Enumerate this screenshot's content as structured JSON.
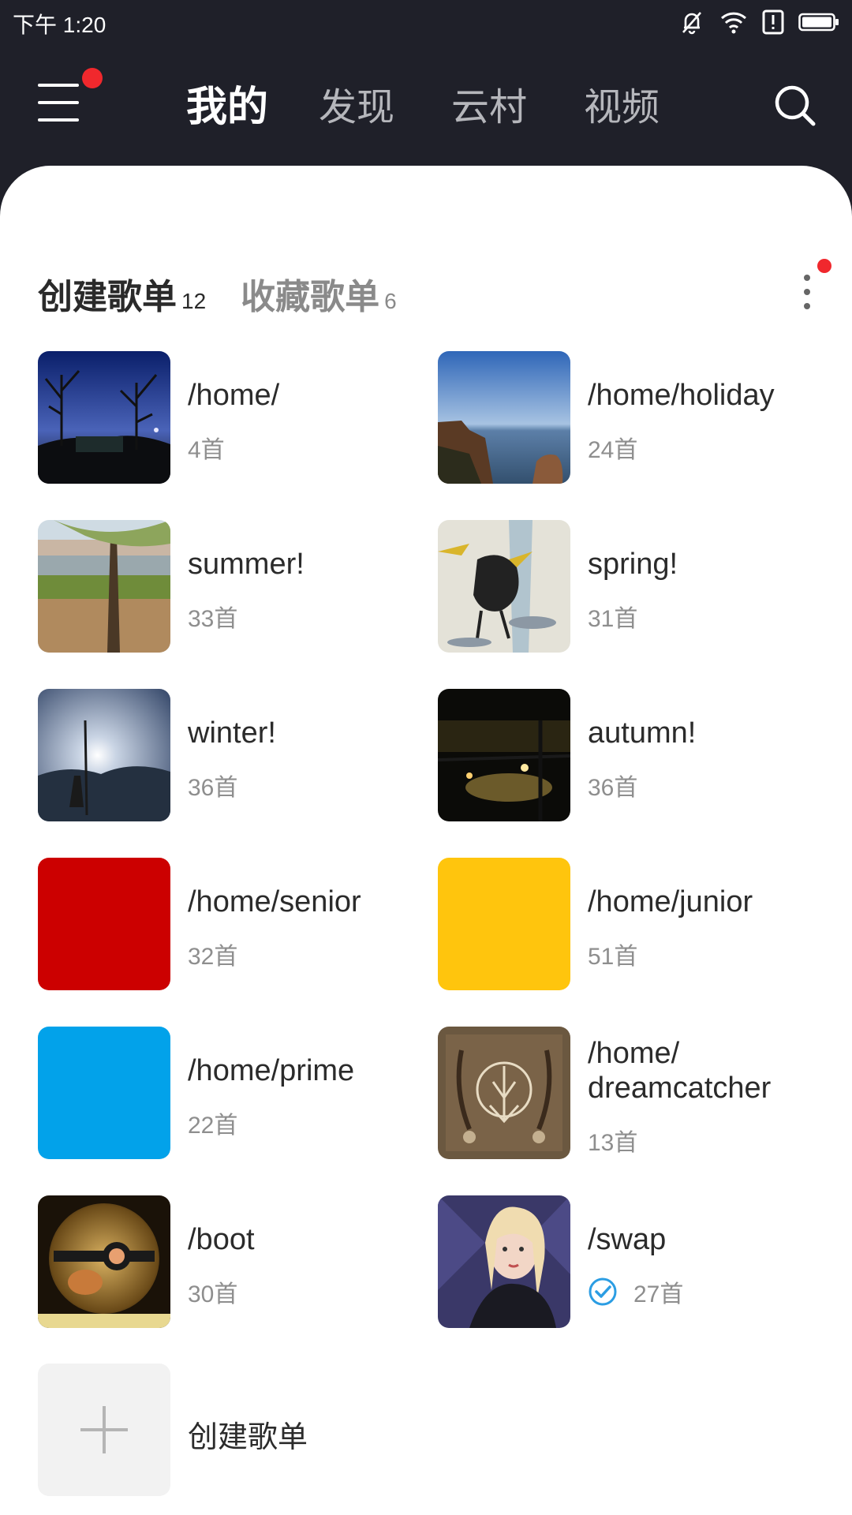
{
  "status_bar": {
    "time": "下午 1:20",
    "icons": [
      "bell-muted-icon",
      "wifi-icon",
      "alert-icon",
      "battery-icon"
    ]
  },
  "nav": {
    "tabs": [
      "我的",
      "发现",
      "云村",
      "视频"
    ],
    "active_tab": 0,
    "menu_badge": true
  },
  "section": {
    "tabs": [
      {
        "label": "创建歌单",
        "count": "12"
      },
      {
        "label": "收藏歌单",
        "count": "6"
      }
    ]
  },
  "playlists": [
    {
      "title": "/home/",
      "count": "4首",
      "cover": "night-park"
    },
    {
      "title": "/home/holiday",
      "count": "24首",
      "cover": "sea-cliff"
    },
    {
      "title": "summer!",
      "count": "33首",
      "cover": "tree-lake"
    },
    {
      "title": "spring!",
      "count": "31首",
      "cover": "ink-bird"
    },
    {
      "title": "winter!",
      "count": "36首",
      "cover": "moon-beach"
    },
    {
      "title": "autumn!",
      "count": "36首",
      "cover": "night-lights"
    },
    {
      "title": "/home/senior",
      "count": "32首",
      "cover": "solid",
      "color": "#cc0000"
    },
    {
      "title": "/home/junior",
      "count": "51首",
      "cover": "solid",
      "color": "#ffc50d"
    },
    {
      "title": "/home/prime",
      "count": "22首",
      "cover": "solid",
      "color": "#02a2ea"
    },
    {
      "title": "/home/\ndreamcatcher",
      "count": "13首",
      "cover": "dreamcatcher-album"
    },
    {
      "title": "/boot",
      "count": "30首",
      "cover": "crystal-ball"
    },
    {
      "title": "/swap",
      "count": "27首",
      "cover": "portrait",
      "verified": true
    }
  ],
  "create": {
    "label": "创建歌单"
  },
  "colors": {
    "header_bg": "#1f2029",
    "badge_red": "#f0282d",
    "check_blue": "#2b9de3"
  }
}
